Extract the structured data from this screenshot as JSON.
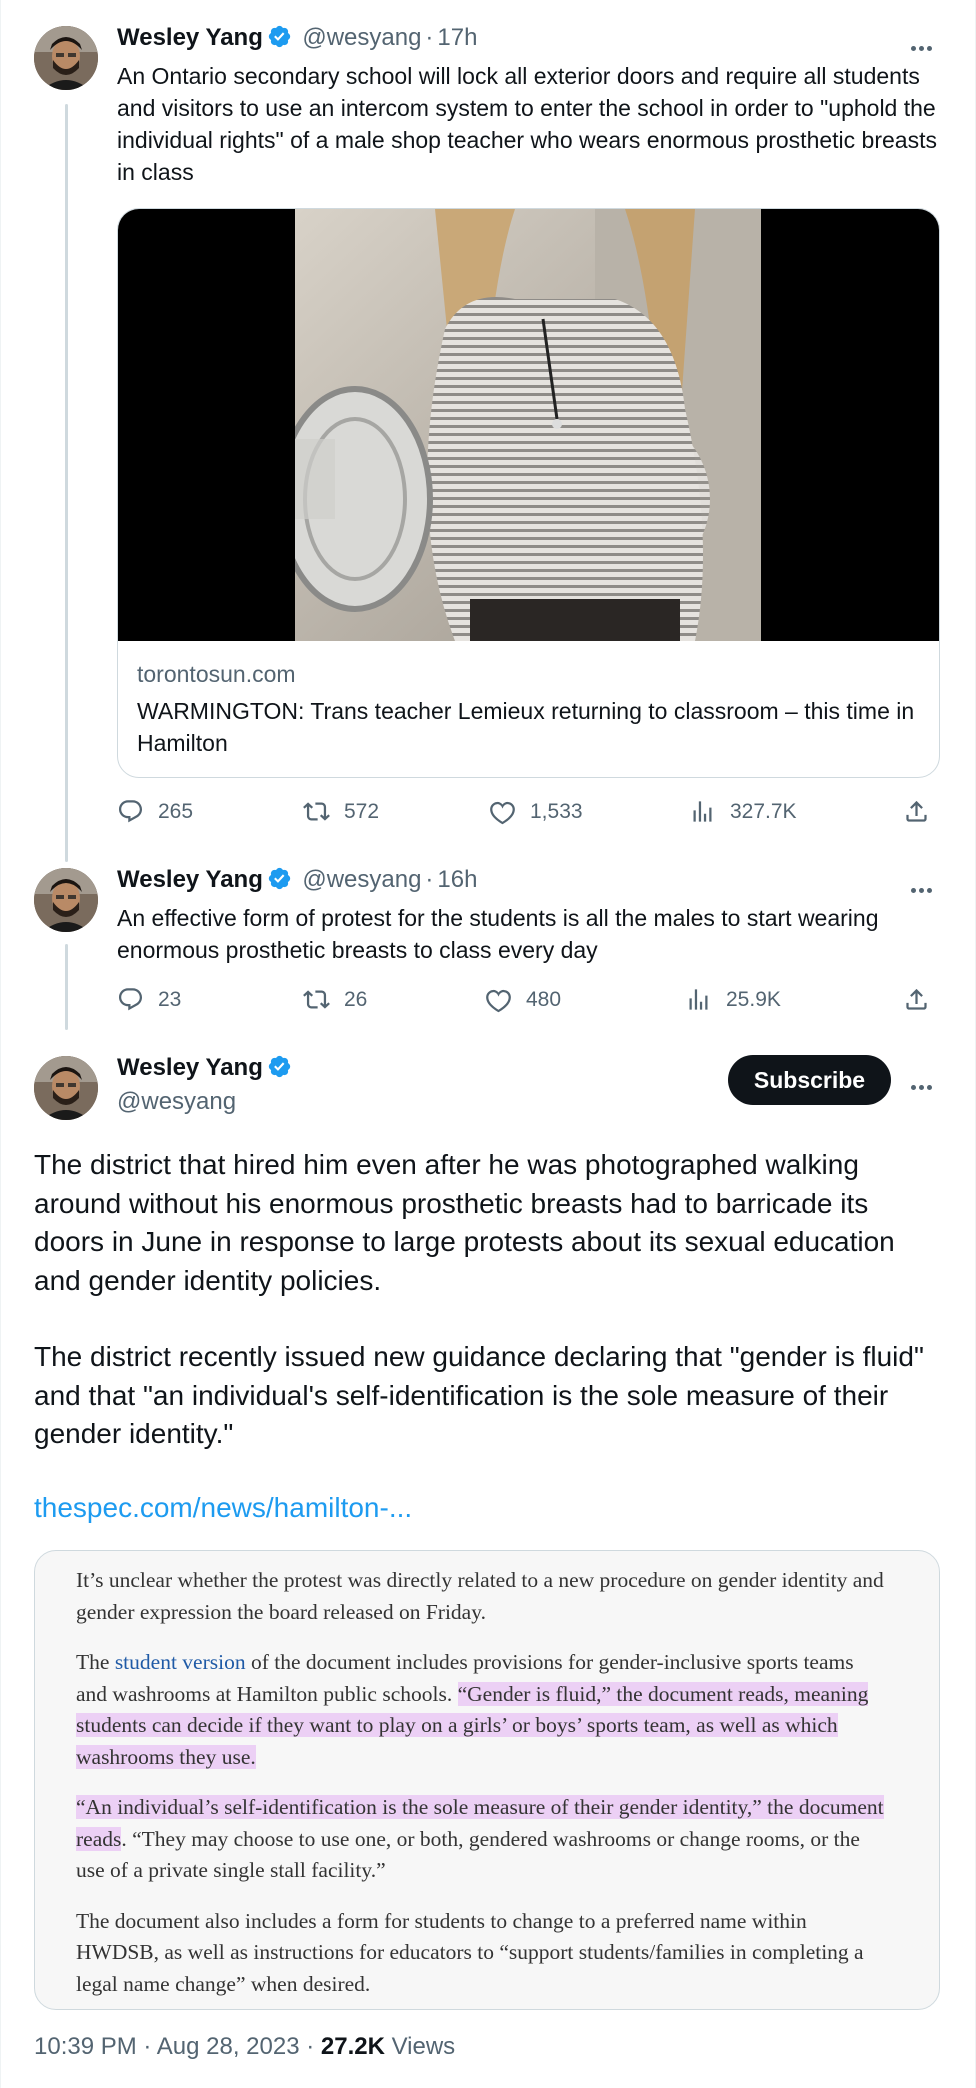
{
  "tweets": [
    {
      "name": "Wesley Yang",
      "handle": "@wesyang",
      "time": "17h",
      "text": "An Ontario secondary school will lock all exterior doors and require all students and visitors to use an intercom system to enter the school in order to \"uphold the individual rights\" of a male shop teacher who wears enormous prosthetic breasts in class",
      "card": {
        "domain": "torontosun.com",
        "title": "WARMINGTON: Trans teacher Lemieux returning to classroom – this time in Hamilton"
      },
      "replies": "265",
      "reposts": "572",
      "likes": "1,533",
      "views": "327.7K"
    },
    {
      "name": "Wesley Yang",
      "handle": "@wesyang",
      "time": "16h",
      "text": "An effective form of protest for the students is all the males to start wearing enormous prosthetic breasts to class every day",
      "replies": "23",
      "reposts": "26",
      "likes": "480",
      "views": "25.9K"
    }
  ],
  "main": {
    "name": "Wesley Yang",
    "handle": "@wesyang",
    "subscribe_label": "Subscribe",
    "paragraph1": "The district that hired him even after he was photographed walking around without his enormous prosthetic breasts had to barricade its doors in June in response to large protests about its sexual education and gender identity policies.",
    "paragraph2": "The district recently issued new guidance declaring that \"gender is fluid\" and that \"an individual's self-identification is the sole measure of their gender identity.\"",
    "link": "thespec.com/news/hamilton-...",
    "quote": {
      "p1": "It’s unclear whether the protest was directly related to a new procedure on gender identity and gender expression the board released on Friday.",
      "p2_a": "The ",
      "p2_link": "student version",
      "p2_b": " of the document includes provisions for gender-inclusive sports teams and washrooms at Hamilton public schools. ",
      "p2_hl": "“Gender is fluid,” the document reads, meaning students can decide if they want to play on a girls’ or boys’ sports team, as well as which washrooms they use.",
      "p3_hl": "“An individual’s self-identification is the sole measure of their gender identity,” the document reads",
      "p3_b": ". “They may choose to use one, or both, gendered washrooms or change rooms, or the use of a private single stall facility.”",
      "p4": "The document also includes a form for students to change to a preferred name within HWDSB, as well as instructions for educators to “support students/families in completing a legal name change” when desired."
    },
    "time": "10:39 PM",
    "date": "Aug 28, 2023",
    "views_count": "27.2K",
    "views_label": "Views"
  },
  "colors": {
    "accent": "#1d9bf0",
    "highlight": "#ecd0f5",
    "muted": "#536471"
  },
  "icons": [
    "verified-badge-icon",
    "more-icon",
    "reply-icon",
    "repost-icon",
    "like-icon",
    "views-icon",
    "share-icon"
  ]
}
